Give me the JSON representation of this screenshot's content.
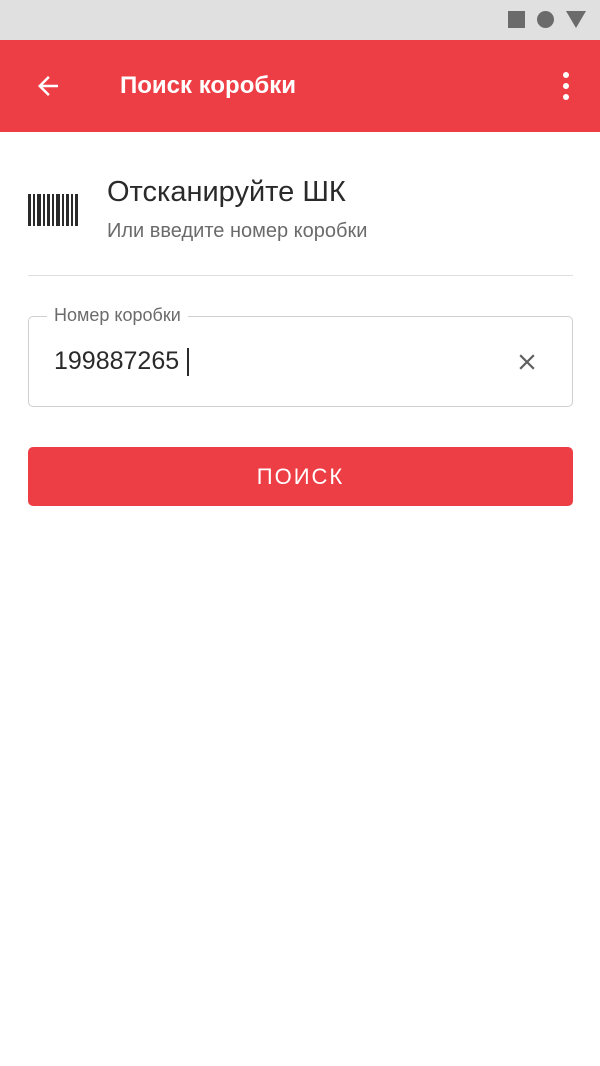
{
  "status_bar": {
    "icons": [
      "square-icon",
      "circle-icon",
      "triangle-icon"
    ]
  },
  "app_bar": {
    "title": "Поиск коробки",
    "back_icon": "arrow-back-icon",
    "menu_icon": "more-vert-icon",
    "color": "#ee3e45"
  },
  "scan_header": {
    "icon": "barcode-icon",
    "title": "Отсканируйте ШК",
    "subtitle": "Или введите номер коробки"
  },
  "box_number_field": {
    "label": "Номер коробки",
    "value": "199887265",
    "clear_icon": "close-icon"
  },
  "search_button": {
    "label": "ПОИСК",
    "color": "#ee3e45"
  }
}
